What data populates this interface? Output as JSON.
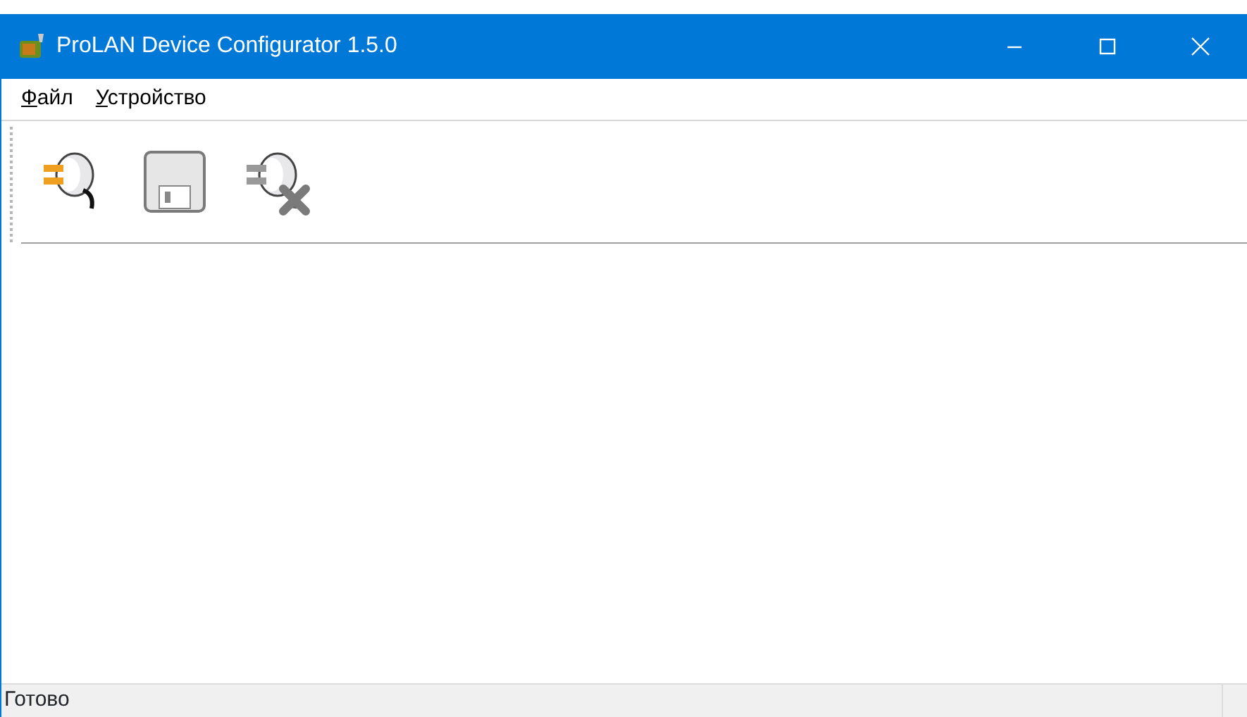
{
  "window": {
    "title": "ProLAN Device Configurator 1.5.0"
  },
  "menu": [
    {
      "label": "Файл",
      "underline_first": true
    },
    {
      "label": "Устройство",
      "underline_first": true
    }
  ],
  "toolbar": [
    {
      "kind": "connect"
    },
    {
      "kind": "save"
    },
    {
      "kind": "disconnect"
    }
  ],
  "status_bar": {
    "text": "Готово"
  }
}
